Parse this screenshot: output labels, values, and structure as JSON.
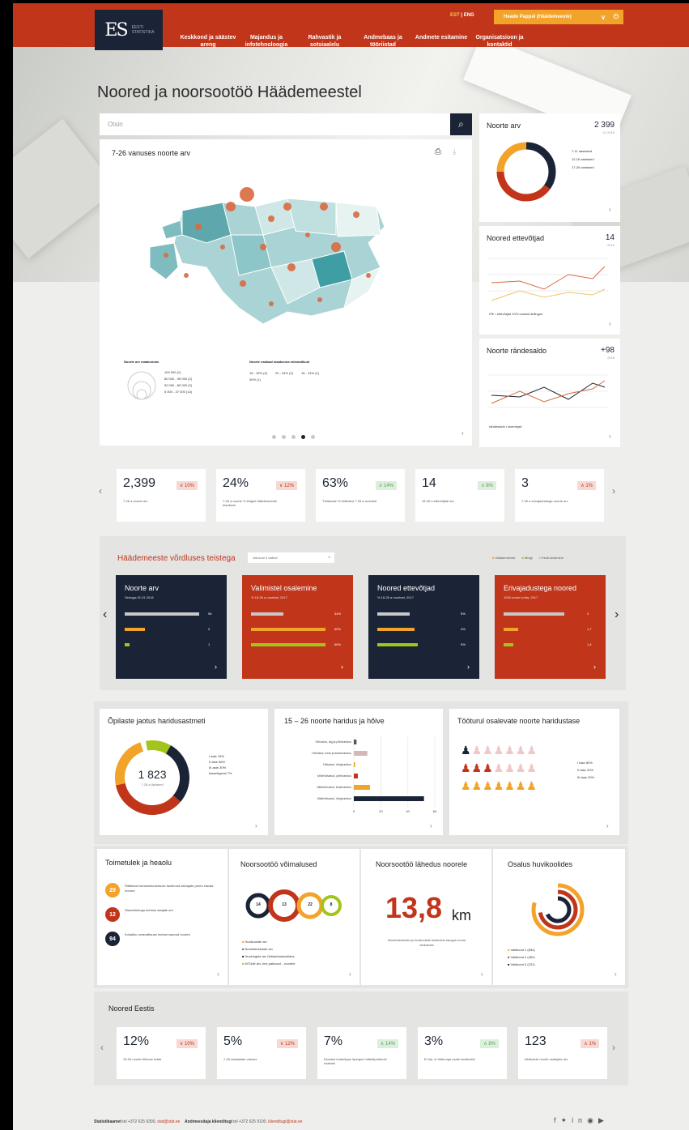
{
  "header": {
    "nav": [
      "Keskkond ja säästev areng",
      "Majandus ja infotehnoloogia",
      "Rahvastik ja sotsiaalelu",
      "Andmebaas ja tööriistad",
      "Andmete esitamine",
      "Organisatsioon ja kontaktid"
    ],
    "lang_est": "EST",
    "lang_sep": " | ",
    "lang_eng": "ENG",
    "user": "Heade Pappel (Häädemeeste)"
  },
  "page": {
    "title": "Noored ja noorsootöö Häädemeestel"
  },
  "search": {
    "placeholder": "Otsin"
  },
  "map_card": {
    "title": "7-26 vanuses noorte arv",
    "legend_left_title": "Noorte arv maakonnas",
    "legend_left": [
      "100 000       (1)",
      "80 000 - 95 000   (2)",
      "50 000 - 80 000   (2)",
      "5 000 - 47 000  (14)"
    ],
    "legend_right_title": "Noorte osakaal maakonna rahvastikust",
    "legend_right": [
      "16 - 15% (3)",
      "20 - 24% (2)",
      "16 - 14% (1)",
      "30% (1)"
    ]
  },
  "side": {
    "youth": {
      "title": "Noorte arv",
      "value": "2 399",
      "date": "01.2018",
      "legend": [
        "7-11 aastased",
        "12-16 aastased",
        "17-26 aastased"
      ],
      "donut": [
        35,
        40,
        25
      ],
      "colors": [
        "#1b2436",
        "#c1351b",
        "#f2a32a"
      ]
    },
    "entre": {
      "title": "Noored ettevõtjad",
      "value": "14",
      "date": "2016",
      "legend": "FIE • ettevõtjad 10% osalust ärilingus"
    },
    "migr": {
      "title": "Noorte rändesaldo",
      "value": "+98",
      "date": "2018",
      "legend": "rändesaldo • sisenejad"
    }
  },
  "kpis": [
    {
      "v": "2,399",
      "b": "∨ 10%",
      "l": "7-26 a noorte arv",
      "c": "down"
    },
    {
      "v": "24%",
      "b": "∨ 12%",
      "l": "7-26 a noorte % kõigist Häädemeeste elanikest",
      "c": "down"
    },
    {
      "v": "63%",
      "b": "∧ 14%",
      "l": "Töötavate % kõikidest 7-26 a noortest",
      "c": "pos"
    },
    {
      "v": "14",
      "b": "∧ 8%",
      "l": "18-26 a ettevõtjate arv",
      "c": "pos"
    },
    {
      "v": "3",
      "b": "∧ 1%",
      "l": "7-26 a erivajadustega noorte arv",
      "c": "up"
    }
  ],
  "compare": {
    "title": "Häädemeeste võrdluses teistega",
    "select": "Vali kuni 4 valikut",
    "legend": [
      "Häädemeeste",
      "Mulgi",
      "Eesti keskmine"
    ],
    "cards": [
      {
        "t": "Noorte arv",
        "s": "Seisuga 01.01.2018",
        "bg": "#1b2436",
        "vals": [
          "96",
          "3",
          "1"
        ],
        "w": [
          92,
          25,
          6
        ]
      },
      {
        "t": "Valimistel osalemine",
        "s": "% 18-26 a noortest, 2017",
        "bg": "#c1351b",
        "vals": [
          "34%",
          "65%",
          "66%"
        ],
        "w": [
          40,
          92,
          92
        ]
      },
      {
        "t": "Noored ettevõtjad",
        "s": "% 18-26 a noortest, 2017",
        "bg": "#1b2436",
        "vals": [
          "5%",
          "4%",
          "9%"
        ],
        "w": [
          40,
          46,
          50
        ]
      },
      {
        "t": "Erivajadustega noored",
        "s": "1000 noore kohta, 2017",
        "bg": "#c1351b",
        "vals": [
          "2",
          "1,7",
          "1,4"
        ],
        "w": [
          75,
          18,
          12
        ]
      }
    ]
  },
  "edu": {
    "title": "Õpilaste jaotus haridusastmeti",
    "total": "1 823",
    "total_sub": "7-26 a õpilased",
    "legend": [
      "I aste 15%",
      "II aste 56%",
      "III aste 30%",
      "kutseõppest 7%"
    ]
  },
  "edu2": {
    "title": "15 – 26 noorte haridus ja hõive",
    "rows": [
      "Hõivatud, alg ja põhiharidus",
      "Hõivatud, kesk ja kutseharidus",
      "Hõivatud, kõrgharidus",
      "Mittehõivatud, põhiharidus",
      "Mittehõivatud, keskharidus",
      "Mittehõivatud, kõrgharidus"
    ],
    "vals": [
      2,
      10,
      1,
      3,
      12,
      52
    ],
    "ticks": [
      "0",
      "20",
      "40",
      "60"
    ]
  },
  "labor": {
    "title": "Tööturul osalevate noorte haridustase",
    "legend": [
      "I tase 80%",
      "II tase 20%",
      "III tase 20%"
    ]
  },
  "wellbeing": {
    "title": "Toimetulek ja heaolu",
    "items": [
      {
        "n": "29",
        "t": "Riikliktud toimetulekutoetuse taotlenud abivajate peres elavad noored"
      },
      {
        "n": "12",
        "t": "Sissetulekuga toetuse saajate arv"
      },
      {
        "n": "94",
        "t": "Kohaliku omavalitsuse toetust saanud noored"
      }
    ]
  },
  "youthwork": {
    "title": "Noorsootöö võimalused",
    "circles": [
      "14",
      "13",
      "22",
      "8"
    ],
    "legend": [
      "Huvikoolide arv",
      "Noortekeskuste arv",
      "Huviringide arv üldhariduskoolides",
      "MTÜde arv, kes pakuvad ...noorele"
    ]
  },
  "distance": {
    "title": "Noorsootöö lähedus noorele",
    "value": "13,8",
    "unit": "km",
    "desc": "Noortekeskuste ja huvikoolide keskmine kaugus noore elukohast"
  },
  "hobby": {
    "title": "Osalus huvikoolides",
    "legend": [
      "Valdkond 1 (834)",
      "Valdkond 2 (452)",
      "Valdkond 3 (231)"
    ]
  },
  "estonia": {
    "title": "Noored Eestis",
    "kpis": [
      {
        "v": "12%",
        "b": "∨ 10%",
        "l": "15-26 noorte töötuse määr",
        "c": "down"
      },
      {
        "v": "5%",
        "b": "∨ 12%",
        "l": "7-26 aastastate vaesus",
        "c": "down"
      },
      {
        "v": "7%",
        "b": "∧ 14%",
        "l": "Esmase kutseõppe õpingud mittelõpetanute osakaal",
        "c": "pos"
      },
      {
        "v": "3%",
        "b": "∧ 8%",
        "l": "Ei õpi, ei tööta ega osale koolitustel",
        "c": "pos"
      },
      {
        "v": "123",
        "b": "∧ 1%",
        "l": "Aktiivsete noorte osalejate arv",
        "c": "up"
      }
    ]
  },
  "footer": {
    "label1": "Statistikaamet",
    "contact1": "tel +372 625 9300,",
    "mail1": "stat@stat.ee",
    "label2": "Andmeesitaja klienditugi",
    "contact2": "tel +372 625 9100,",
    "mail2": "klienditugi@stat.ee"
  }
}
